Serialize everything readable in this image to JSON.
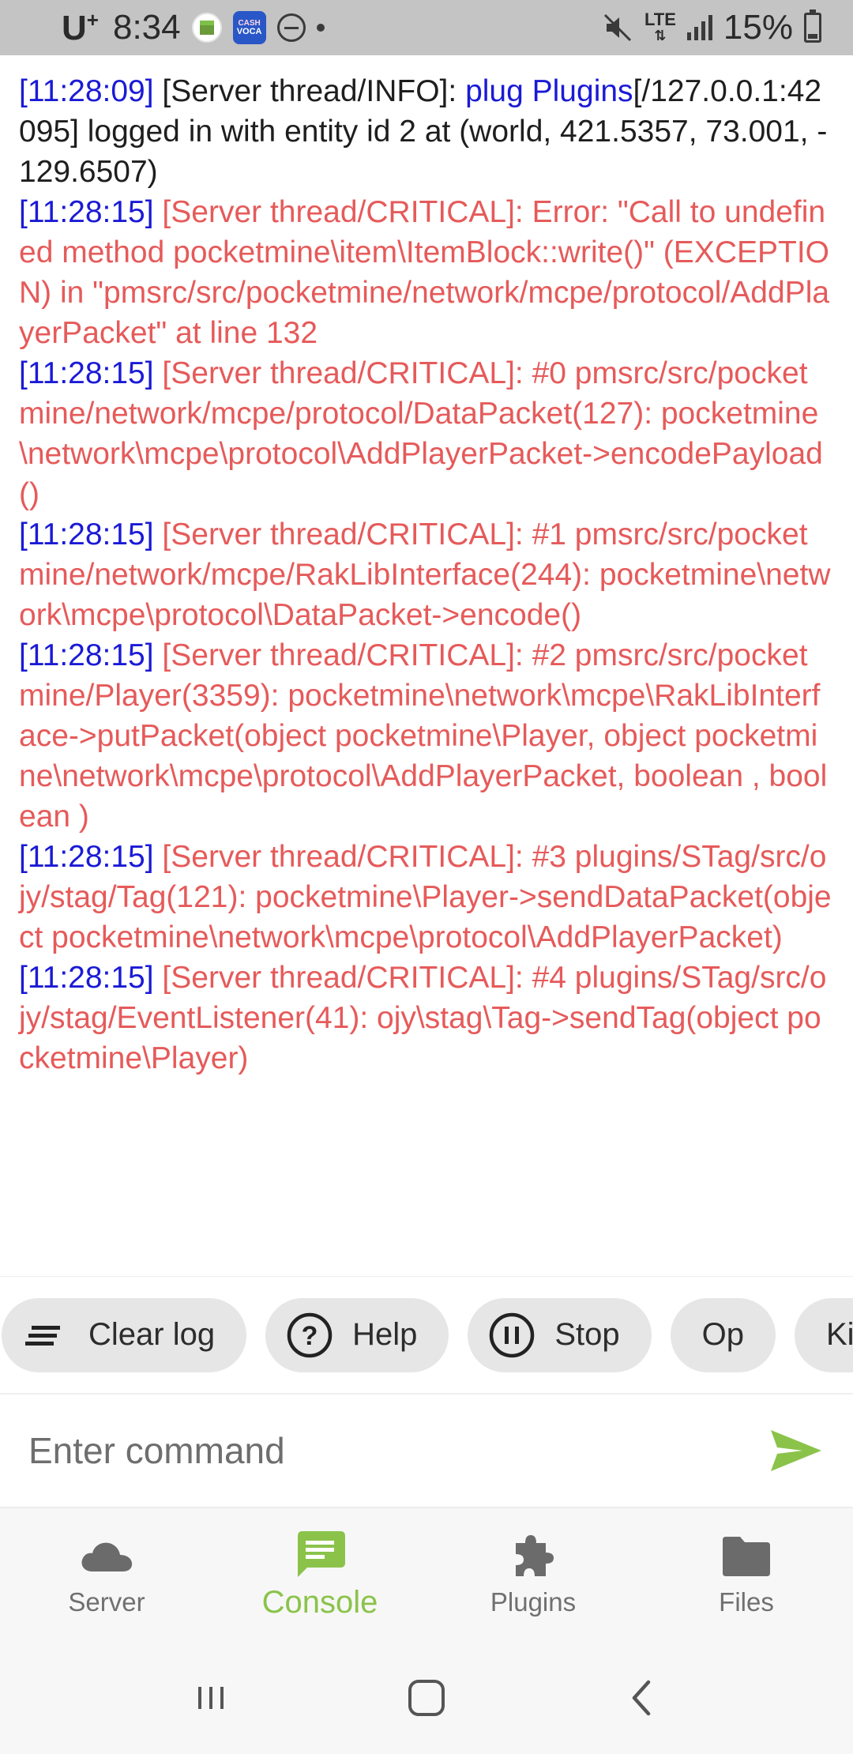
{
  "status_bar": {
    "carrier": "U",
    "carrier_sup": "+",
    "time": "8:34",
    "cash_icon_top": "CASH",
    "cash_icon_bottom": "VOCA",
    "network": "LTE",
    "battery": "15%"
  },
  "console": {
    "lines": [
      {
        "ts": "[11:28:09]",
        "prefix": " [Server thread/INFO]: ",
        "name": "plug Plugins",
        "text": "[/127.0.0.1:42095] logged in with entity id 2 at (world, 421.5357, 73.001, -129.6507)",
        "level": "info"
      },
      {
        "ts": "[11:28:15]",
        "text": " [Server thread/CRITICAL]: Error: \"Call to undefined method pocketmine\\item\\ItemBlock::write()\" (EXCEPTION) in \"pmsrc/src/pocketmine/network/mcpe/protocol/AddPlayerPacket\" at line 132",
        "level": "critical"
      },
      {
        "ts": "[11:28:15]",
        "text": " [Server thread/CRITICAL]: #0 pmsrc/src/pocketmine/network/mcpe/protocol/DataPacket(127): pocketmine\\network\\mcpe\\protocol\\AddPlayerPacket->encodePayload()",
        "level": "critical"
      },
      {
        "ts": "[11:28:15]",
        "text": " [Server thread/CRITICAL]: #1 pmsrc/src/pocketmine/network/mcpe/RakLibInterface(244): pocketmine\\network\\mcpe\\protocol\\DataPacket->encode()",
        "level": "critical"
      },
      {
        "ts": "[11:28:15]",
        "text": " [Server thread/CRITICAL]: #2 pmsrc/src/pocketmine/Player(3359): pocketmine\\network\\mcpe\\RakLibInterface->putPacket(object pocketmine\\Player, object pocketmine\\network\\mcpe\\protocol\\AddPlayerPacket, boolean , boolean )",
        "level": "critical"
      },
      {
        "ts": "[11:28:15]",
        "text": " [Server thread/CRITICAL]: #3 plugins/STag/src/ojy/stag/Tag(121): pocketmine\\Player->sendDataPacket(object pocketmine\\network\\mcpe\\protocol\\AddPlayerPacket)",
        "level": "critical"
      },
      {
        "ts": "[11:28:15]",
        "text": " [Server thread/CRITICAL]: #4 plugins/STag/src/ojy/stag/EventListener(41): ojy\\stag\\Tag->sendTag(object pocketmine\\Player)",
        "level": "critical"
      }
    ]
  },
  "chips": {
    "clear_log": "Clear log",
    "help": "Help",
    "stop": "Stop",
    "op": "Op",
    "kick": "Kick"
  },
  "command": {
    "placeholder": "Enter command"
  },
  "bottom_nav": {
    "server": "Server",
    "console": "Console",
    "plugins": "Plugins",
    "files": "Files"
  },
  "colors": {
    "accent": "#8bc34a",
    "timestamp": "#1a1ad6",
    "critical": "#e65a5a"
  }
}
